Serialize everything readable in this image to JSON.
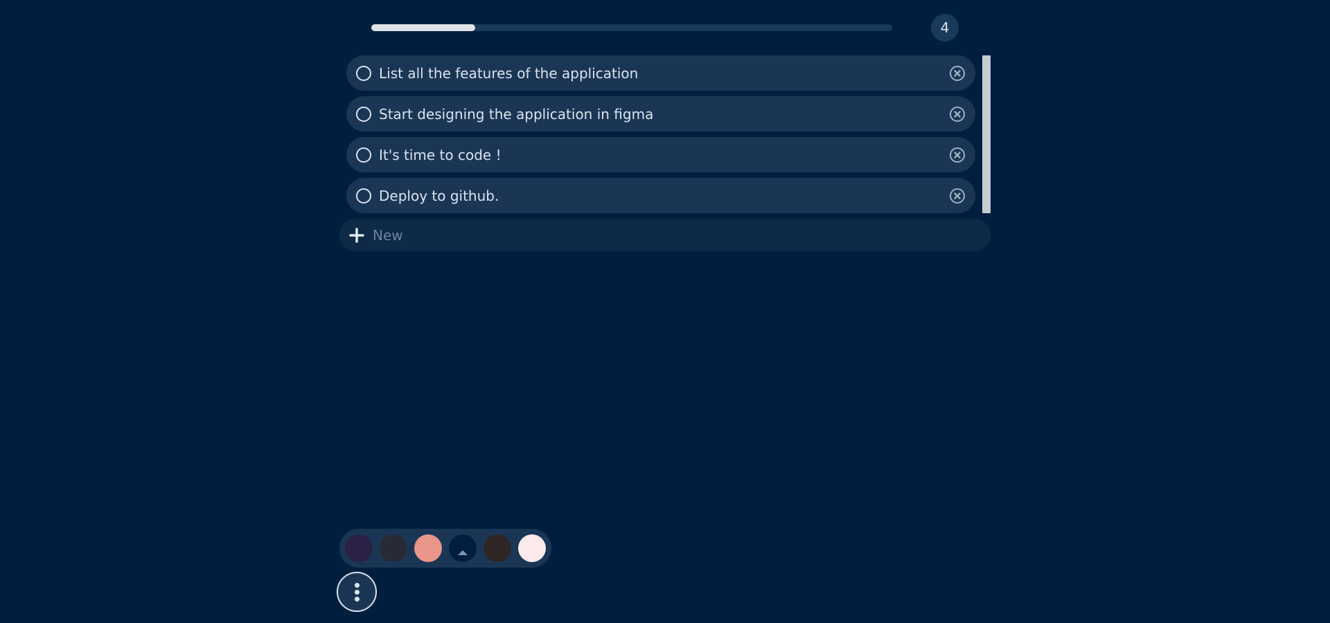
{
  "progress": {
    "fraction": 0.2,
    "track_color": "#1a3a5c",
    "fill_color": "#dfe3e8"
  },
  "counter": {
    "value": "4"
  },
  "tasks": [
    {
      "label": "List all the features of the application",
      "done": false,
      "check_icon": "circle-icon",
      "delete_icon": "close-circle-icon"
    },
    {
      "label": "Start designing the application in figma",
      "done": false,
      "check_icon": "circle-icon",
      "delete_icon": "close-circle-icon"
    },
    {
      "label": "It's time to code !",
      "done": false,
      "check_icon": "circle-icon",
      "delete_icon": "close-circle-icon"
    },
    {
      "label": "Deploy to github.",
      "done": false,
      "check_icon": "circle-icon",
      "delete_icon": "close-circle-icon"
    }
  ],
  "new_task": {
    "placeholder": "New",
    "value": "",
    "icon": "plus-icon"
  },
  "theme_swatches": [
    {
      "color": "#2a2145",
      "selected": false
    },
    {
      "color": "#282a36",
      "selected": false
    },
    {
      "color": "#e8968a",
      "selected": false
    },
    {
      "color": "#001f3f",
      "selected": true
    },
    {
      "color": "#2e2625",
      "selected": false
    },
    {
      "color": "#fbe9ec",
      "selected": false
    }
  ],
  "menu": {
    "icon": "more-vertical-icon"
  },
  "colors": {
    "background": "#001f3f",
    "card": "#1b3655",
    "text": "#dbe4ee",
    "placeholder": "#6b84a0"
  }
}
